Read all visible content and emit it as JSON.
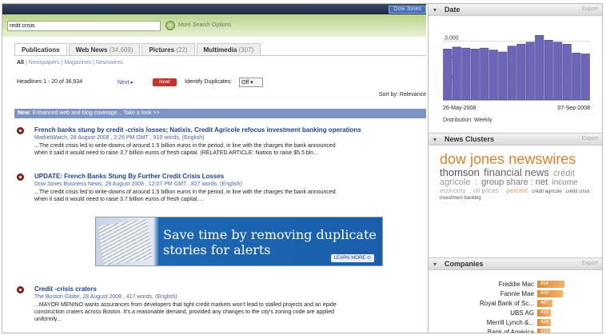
{
  "header": {
    "dow_jones_tab": "Dow Jones"
  },
  "search": {
    "query": "redit crisis",
    "more_options": "More Search Options"
  },
  "tabs": [
    {
      "label": "Publications",
      "count": ""
    },
    {
      "label": "Web News",
      "count": "(34,609)"
    },
    {
      "label": "Pictures",
      "count": "(22)"
    },
    {
      "label": "Multimedia",
      "count": "(307)"
    }
  ],
  "subfilters": {
    "all": "All",
    "items": [
      "Newspapers",
      "Magazines",
      "Newswires"
    ]
  },
  "results": {
    "headline_count": "Headlines 1 - 20 of 36,934",
    "next": "Next ▸",
    "new_badge": "New!",
    "dup_label": "Identify Duplicates:",
    "dup_value": "Off",
    "sort_by": "Sort by: Relevance"
  },
  "banner": {
    "new": "New:",
    "text": "Enhanced web and blog coverage... Take a look >>"
  },
  "articles": [
    {
      "title": "French banks stung by credit -crisis losses; Natixis, Credit Agricole refocus investment banking operations",
      "meta": "MarketWatch, 28 August 2008 , 2:26 PM GMT , 919 words, (English)",
      "snippet1": "...The credit crisis led to write-downs of around 1.5 billion euros in the period, in line with the charges the bank announced",
      "snippet2": "when it said it would need to raise 3.7 billion euros of fresh capital. (RELATED ARTICLE: Natixis to raise $5.5 bln..."
    },
    {
      "title": "UPDATE: French Banks Stung By Further Credit Crisis Losses",
      "meta": "Dow Jones Business News, 28 August 2008 , 12:07 PM GMT , 827 words, (English)",
      "snippet1": "...The credit crisis led to write-downs of around 1.5 billion euros in the period, in line with the charges the bank announced",
      "snippet2": "when it said it would need to raise 3.7 billion euros of fresh capital...."
    },
    {
      "title": "Credit -crisis craters",
      "meta": "The Boston Globe, 28 August 2008 , 417 words, (English)",
      "snippet1": "...MAYOR MENINO wants assurances from developers that tight credit markets won't lead to stalled projects and an epide",
      "snippet2": "construction craters across Boston. It's a reasonable demand, provided any changes to the city's zoning code are applied",
      "snippet3": "uniformly..."
    }
  ],
  "ad": {
    "text": "Save time by removing duplicate stories for alerts",
    "button": "LEARN MORE ⊙"
  },
  "date_panel": {
    "title": "Date",
    "export": "Export",
    "distribution": "Distribution: Weekly",
    "start_label": "26-May-2008",
    "end_label": "07-Sep-2008"
  },
  "chart_data": {
    "type": "bar",
    "title": "Date",
    "xlabel": "",
    "ylabel": "",
    "ylim": [
      0,
      4000
    ],
    "yticks": [
      "0",
      "1,000",
      "2,000",
      "3,000"
    ],
    "x_range": [
      "26-May-2008",
      "07-Sep-2008"
    ],
    "values": [
      2600,
      2700,
      2650,
      2600,
      2650,
      2550,
      2450,
      2750,
      2850,
      2950,
      3300,
      3050,
      2950,
      2850,
      2400,
      2350
    ],
    "color": "#6b66b8",
    "grid": true
  },
  "clusters": {
    "title": "News Clusters",
    "export": "Export",
    "terms": [
      {
        "text": "dow jones",
        "size": 18,
        "color": "#d9822b"
      },
      {
        "text": "newswires",
        "size": 18,
        "color": "#d9822b"
      },
      {
        "text": "thomson",
        "size": 13,
        "color": "#555555"
      },
      {
        "text": "financial news",
        "size": 13,
        "color": "#666666"
      },
      {
        "text": "crédit agricole",
        "size": 11,
        "color": "#999999"
      },
      {
        "text": ":",
        "size": 11,
        "color": "#999999"
      },
      {
        "text": "group share : net",
        "size": 11,
        "color": "#777777"
      },
      {
        "text": "income",
        "size": 10,
        "color": "#888888"
      },
      {
        "text": "economy",
        "size": 8,
        "color": "#aaaaaa"
      },
      {
        "text": ": oil prices :",
        "size": 8,
        "color": "#aaaaaa"
      },
      {
        "text": "percent",
        "size": 8,
        "color": "#d9a06a"
      },
      {
        "text": "crédit agricole : crédit crisis :",
        "size": 6,
        "color": "#555555"
      },
      {
        "text": "investment banking",
        "size": 6,
        "color": "#555555"
      }
    ]
  },
  "companies": {
    "title": "Companies",
    "export": "Export",
    "items": [
      {
        "name": "Freddie Mac",
        "value": 864
      },
      {
        "name": "Fannie Mae",
        "value": 809
      },
      {
        "name": "Royal Bank of Sc...",
        "value": 487
      },
      {
        "name": "UBS AG",
        "value": 433
      },
      {
        "name": "Merrill Lynch &...",
        "value": 424
      },
      {
        "name": "Bank of America",
        "value": 414
      }
    ]
  }
}
